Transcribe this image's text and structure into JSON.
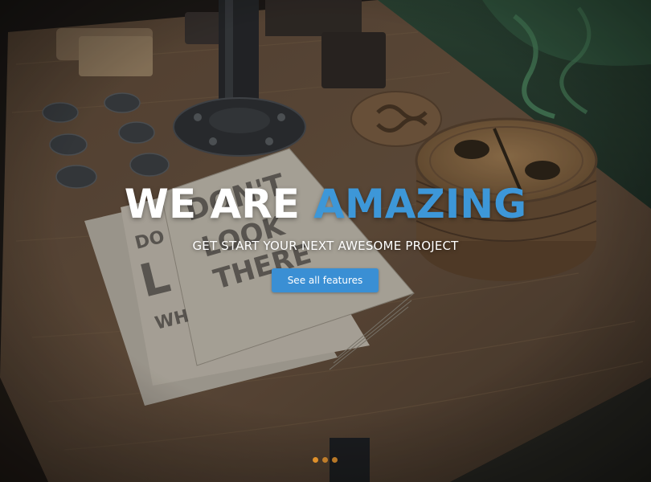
{
  "hero": {
    "headline_part1": "WE ARE",
    "headline_part2": "AMAZING",
    "subheadline": "GET START YOUR NEXT AWESOME PROJECT",
    "cta_label": "See all features"
  },
  "slider": {
    "dot_count": 3,
    "active_index": 0
  },
  "colors": {
    "accent_blue": "#3d97d8",
    "button_blue": "#3a8fd4",
    "dot_orange": "#e0902a",
    "headline_white": "#ffffff"
  }
}
